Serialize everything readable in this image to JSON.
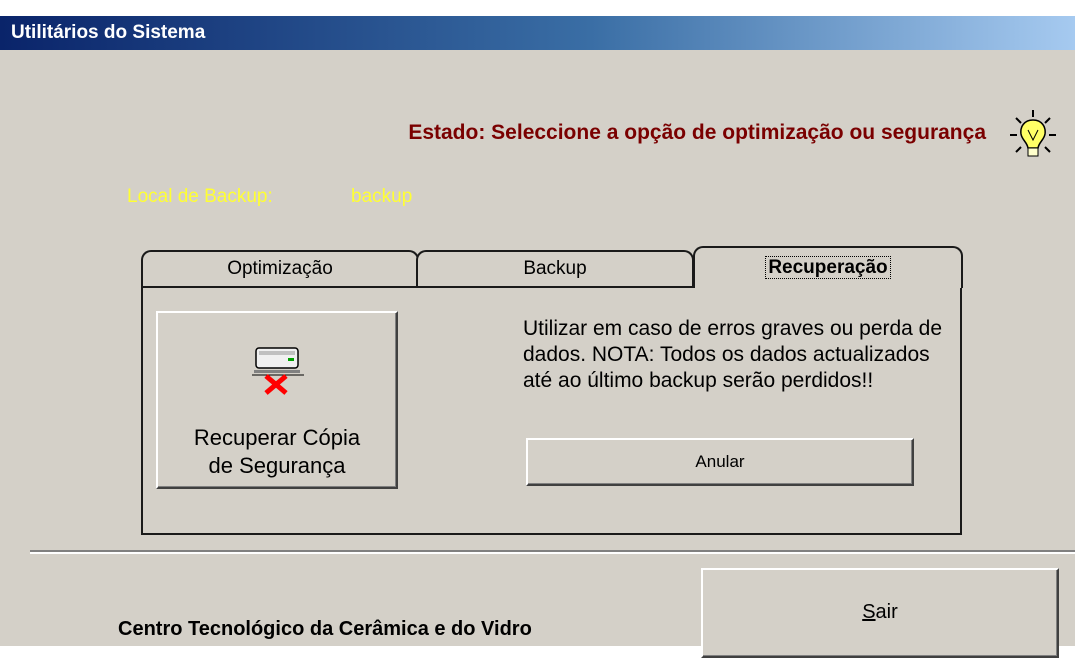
{
  "window": {
    "title": "Utilitários do Sistema"
  },
  "status": {
    "text": "Estado: Seleccione a opção de optimização ou segurança",
    "icon": "lightbulb-icon"
  },
  "backup_location": {
    "label": "Local de Backup:",
    "value": "backup"
  },
  "tabs": [
    {
      "label": "Optimização",
      "active": false
    },
    {
      "label": "Backup",
      "active": false
    },
    {
      "label": "Recuperação",
      "active": true
    }
  ],
  "recovery": {
    "restore_button": {
      "line1": "Recuperar Cópia",
      "line2": "de Segurança",
      "icon": "restore-backup-icon"
    },
    "info_text": "Utilizar em caso de erros graves ou perda de dados. NOTA: Todos os dados actualizados até ao último backup serão perdidos!!",
    "cancel_label": "Anular"
  },
  "footer": {
    "org": "Centro Tecnológico da Cerâmica e do Vidro"
  },
  "exit_button": {
    "mnemonic": "S",
    "rest": "air"
  },
  "colors": {
    "status": "#7a0000",
    "backup_text": "#ffff33",
    "titlebar": "#0a246a"
  }
}
